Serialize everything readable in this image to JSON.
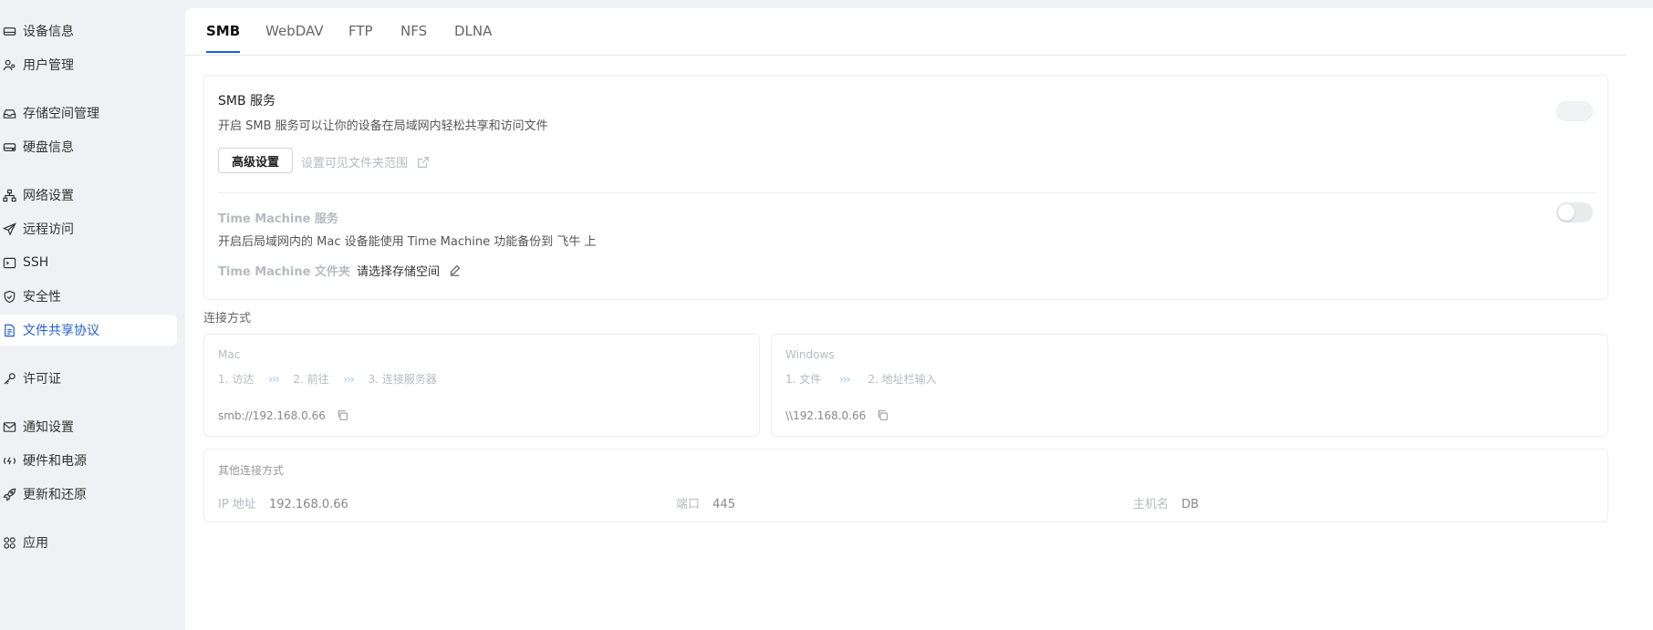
{
  "sidebar": {
    "items": [
      {
        "label": "设备信息",
        "icon": "disk-icon"
      },
      {
        "label": "用户管理",
        "icon": "users-icon"
      },
      {
        "label": "存储空间管理",
        "icon": "inbox-icon"
      },
      {
        "label": "硬盘信息",
        "icon": "hard-drive-icon"
      },
      {
        "label": "网络设置",
        "icon": "network-icon"
      },
      {
        "label": "远程访问",
        "icon": "send-icon"
      },
      {
        "label": "SSH",
        "icon": "terminal-icon"
      },
      {
        "label": "安全性",
        "icon": "shield-icon"
      },
      {
        "label": "文件共享协议",
        "icon": "document-icon"
      },
      {
        "label": "许可证",
        "icon": "key-icon"
      },
      {
        "label": "通知设置",
        "icon": "mail-icon"
      },
      {
        "label": "硬件和电源",
        "icon": "power-icon"
      },
      {
        "label": "更新和还原",
        "icon": "rocket-icon"
      },
      {
        "label": "应用",
        "icon": "apps-grid-icon"
      }
    ],
    "active_index": 8,
    "accent": "#1d5fd6"
  },
  "tabs": [
    "SMB",
    "WebDAV",
    "FTP",
    "NFS",
    "DLNA"
  ],
  "smb": {
    "title": "SMB 服务",
    "desc": "开启 SMB 服务可以让你的设备在局域网内轻松共享和访问文件",
    "advanced_btn": "高级设置",
    "visible_scope_link": "设置可见文件夹范围",
    "enabled": false
  },
  "time_machine": {
    "title": "Time Machine 服务",
    "desc": "开启后局域网内的 Mac 设备能使用 Time Machine 功能备份到 飞牛 上",
    "folder_label": "Time Machine 文件夹",
    "folder_value": "请选择存储空间",
    "enabled": false
  },
  "connection": {
    "heading": "连接方式",
    "mac": {
      "title": "Mac",
      "steps": [
        "1. 访达",
        "2. 前往",
        "3. 连接服务器"
      ],
      "address": "smb://192.168.0.66"
    },
    "windows": {
      "title": "Windows",
      "steps": [
        "1. 文件",
        "2. 地址栏输入"
      ],
      "address": "\\\\192.168.0.66"
    },
    "step_separator": "›››"
  },
  "other": {
    "heading": "其他连接方式",
    "ip_label": "IP 地址",
    "ip_value": "192.168.0.66",
    "port_label": "端口",
    "port_value": "445",
    "host_label": "主机名",
    "host_value": "DB"
  }
}
